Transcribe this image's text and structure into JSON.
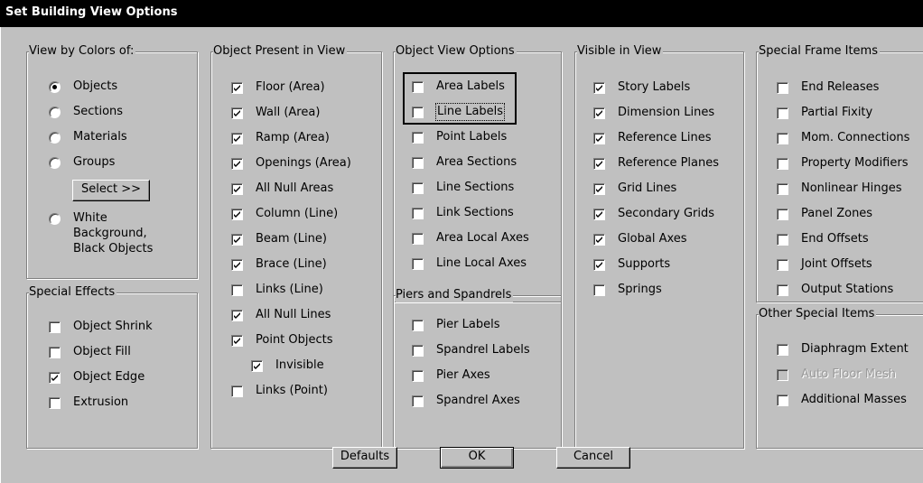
{
  "window": {
    "title": "Set Building View Options"
  },
  "groups": {
    "view_by_colors": {
      "legend": "View by Colors of:",
      "options": [
        {
          "label": "Objects",
          "selected": true
        },
        {
          "label": "Sections",
          "selected": false
        },
        {
          "label": "Materials",
          "selected": false
        },
        {
          "label": "Groups",
          "selected": false
        }
      ],
      "select_button": "Select >>",
      "white_bg": {
        "line1": "White",
        "line2": "Background,",
        "line3": "Black Objects",
        "selected": false
      }
    },
    "special_effects": {
      "legend": "Special Effects",
      "items": [
        {
          "label": "Object Shrink",
          "checked": false
        },
        {
          "label": "Object Fill",
          "checked": false
        },
        {
          "label": "Object Edge",
          "checked": true
        },
        {
          "label": "Extrusion",
          "checked": false
        }
      ]
    },
    "object_present": {
      "legend": "Object Present in View",
      "items": [
        {
          "label": "Floor (Area)",
          "checked": true
        },
        {
          "label": "Wall (Area)",
          "checked": true
        },
        {
          "label": "Ramp (Area)",
          "checked": true
        },
        {
          "label": "Openings (Area)",
          "checked": true
        },
        {
          "label": "All Null Areas",
          "checked": true
        },
        {
          "label": "Column (Line)",
          "checked": true
        },
        {
          "label": "Beam (Line)",
          "checked": true
        },
        {
          "label": "Brace (Line)",
          "checked": true
        },
        {
          "label": "Links (Line)",
          "checked": false
        },
        {
          "label": "All Null Lines",
          "checked": true
        },
        {
          "label": "Point Objects",
          "checked": true
        },
        {
          "label": "Invisible",
          "checked": true
        },
        {
          "label": "Links (Point)",
          "checked": false
        }
      ]
    },
    "object_view_options": {
      "legend": "Object View Options",
      "items": [
        {
          "label": "Area Labels",
          "checked": false
        },
        {
          "label": "Line Labels",
          "checked": false
        },
        {
          "label": "Point Labels",
          "checked": false
        },
        {
          "label": "Area Sections",
          "checked": false
        },
        {
          "label": "Line Sections",
          "checked": false
        },
        {
          "label": "Link Sections",
          "checked": false
        },
        {
          "label": "Area Local Axes",
          "checked": false
        },
        {
          "label": "Line Local Axes",
          "checked": false
        }
      ]
    },
    "piers_spandrels": {
      "legend": "Piers and Spandrels",
      "items": [
        {
          "label": "Pier Labels",
          "checked": false
        },
        {
          "label": "Spandrel Labels",
          "checked": false
        },
        {
          "label": "Pier Axes",
          "checked": false
        },
        {
          "label": "Spandrel Axes",
          "checked": false
        }
      ]
    },
    "visible_in_view": {
      "legend": "Visible in View",
      "items": [
        {
          "label": "Story Labels",
          "checked": true
        },
        {
          "label": "Dimension Lines",
          "checked": true
        },
        {
          "label": "Reference Lines",
          "checked": true
        },
        {
          "label": "Reference Planes",
          "checked": true
        },
        {
          "label": "Grid Lines",
          "checked": true
        },
        {
          "label": "Secondary Grids",
          "checked": true
        },
        {
          "label": "Global Axes",
          "checked": true
        },
        {
          "label": "Supports",
          "checked": true
        },
        {
          "label": "Springs",
          "checked": false
        }
      ]
    },
    "special_frame": {
      "legend": "Special Frame Items",
      "items": [
        {
          "label": "End Releases",
          "checked": false
        },
        {
          "label": "Partial Fixity",
          "checked": false
        },
        {
          "label": "Mom. Connections",
          "checked": false
        },
        {
          "label": "Property Modifiers",
          "checked": false
        },
        {
          "label": "Nonlinear Hinges",
          "checked": false
        },
        {
          "label": "Panel Zones",
          "checked": false
        },
        {
          "label": "End Offsets",
          "checked": false
        },
        {
          "label": "Joint Offsets",
          "checked": false
        },
        {
          "label": "Output Stations",
          "checked": false
        }
      ]
    },
    "other_special": {
      "legend": "Other Special Items",
      "items": [
        {
          "label": "Diaphragm Extent",
          "checked": false
        },
        {
          "label": "Auto Floor Mesh",
          "checked": false,
          "disabled": true
        },
        {
          "label": "Additional Masses",
          "checked": false
        }
      ]
    }
  },
  "buttons": {
    "defaults": "Defaults",
    "ok": "OK",
    "cancel": "Cancel"
  },
  "colors": {
    "face": "#c0c0c0",
    "titlebar": "#000000",
    "shadow": "#808080",
    "highlight": "#ffffff"
  }
}
